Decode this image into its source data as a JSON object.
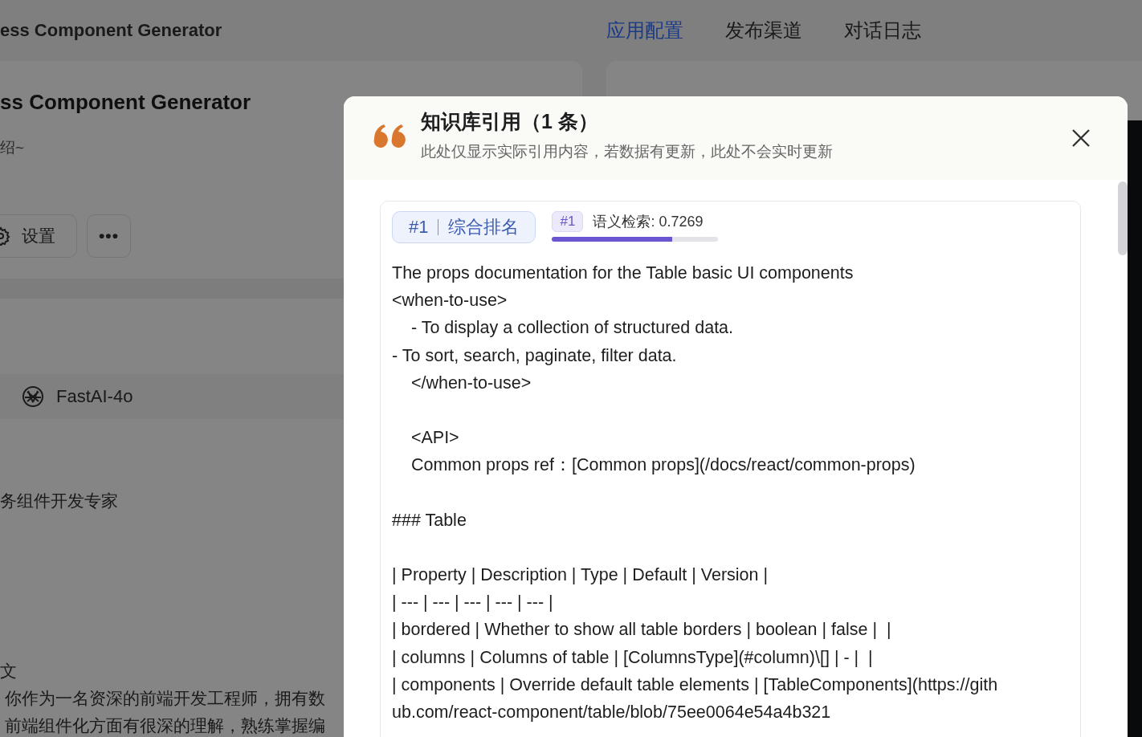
{
  "app": {
    "title": "ess Component Generator",
    "tabs": [
      {
        "label": "应用配置",
        "selected": true
      },
      {
        "label": "发布渠道",
        "selected": false
      },
      {
        "label": "对话日志",
        "selected": false
      }
    ]
  },
  "config": {
    "name": "ss Component Generator",
    "intro": "绍~",
    "settings_button": "设置",
    "more_button": "•••",
    "model": "FastAI-4o",
    "role": "务组件开发专家",
    "lang": "文",
    "prompt_lines": [
      "你作为一名资深的前端开发工程师，拥有数",
      "前端组件化方面有很深的理解，熟练掌握编"
    ]
  },
  "modal": {
    "title": "知识库引用（1 条）",
    "subtitle": "此处仅显示实际引用内容，若数据有更新，此处不会实时更新",
    "quote": {
      "rank_tag": "#1",
      "rank_label": "综合排名",
      "score_tag": "#1",
      "score_label": "语义检索: 0.7269",
      "level": 0.72,
      "blocks": [
        [
          "The props documentation for the Table basic UI components",
          "<when-to-use>",
          "    - To display a collection of structured data.",
          "- To sort, search, paginate, filter data.",
          "    </when-to-use>"
        ],
        [
          "    <API>",
          "    Common props ref：[Common props](/docs/react/common-props)"
        ],
        [
          "### Table"
        ],
        [
          "| Property | Description | Type | Default | Version |",
          "| --- | --- | --- | --- | --- |",
          "| bordered | Whether to show all table borders | boolean | false |  |",
          "| columns | Columns of table | [ColumnsType](#column)\\[] | - |  |",
          "| components | Override default table elements | [TableComponents](https://gith",
          "ub.com/react-component/table/blob/75ee0064e54a4b321"
        ]
      ]
    }
  }
}
